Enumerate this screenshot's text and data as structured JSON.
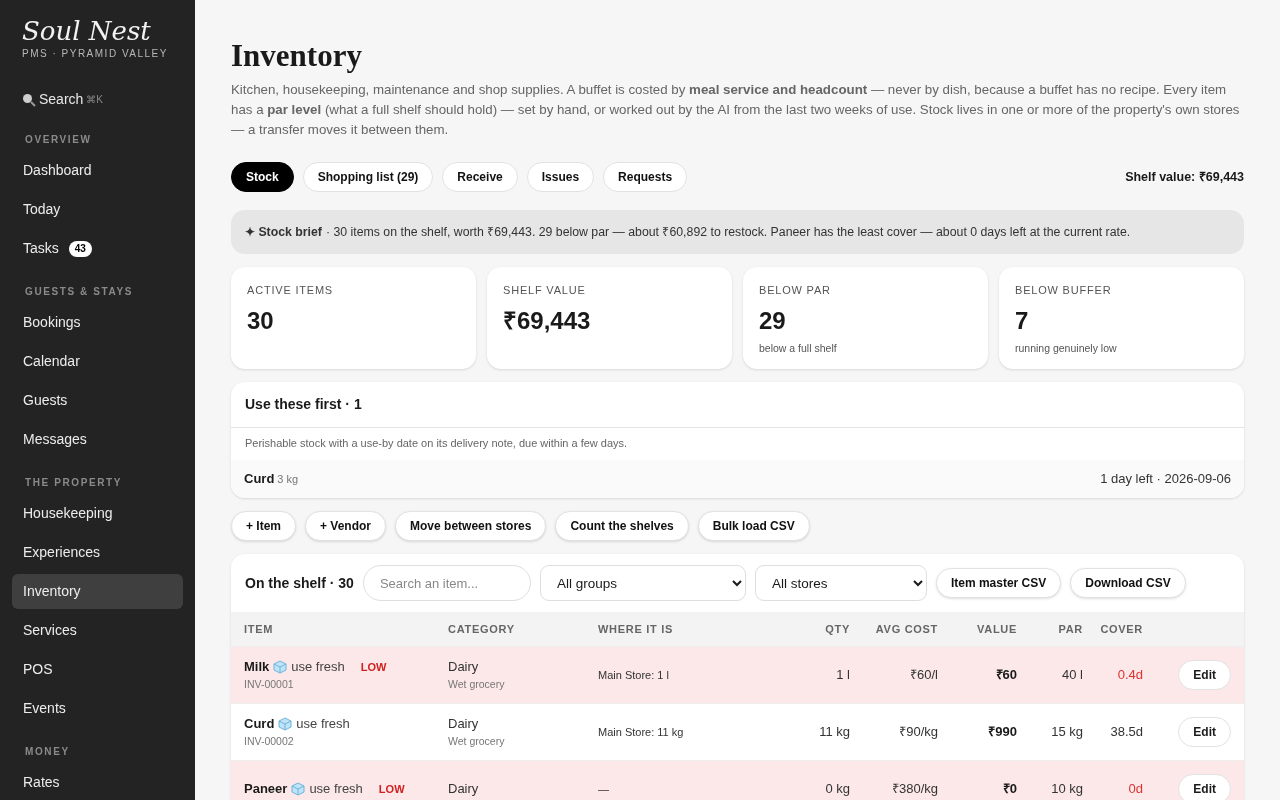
{
  "brand": {
    "logo": "Soul Nest",
    "subtitle": "PMS · PYRAMID VALLEY"
  },
  "search": {
    "label": "Search",
    "shortcut": "⌘K"
  },
  "sidebar": {
    "sections": [
      {
        "heading": "OVERVIEW",
        "items": [
          {
            "label": "Dashboard",
            "selected": false
          },
          {
            "label": "Today",
            "selected": false
          },
          {
            "label": "Tasks",
            "selected": false,
            "badge": "43"
          }
        ]
      },
      {
        "heading": "GUESTS & STAYS",
        "items": [
          {
            "label": "Bookings",
            "selected": false
          },
          {
            "label": "Calendar",
            "selected": false
          },
          {
            "label": "Guests",
            "selected": false
          },
          {
            "label": "Messages",
            "selected": false
          }
        ]
      },
      {
        "heading": "THE PROPERTY",
        "items": [
          {
            "label": "Housekeeping",
            "selected": false
          },
          {
            "label": "Experiences",
            "selected": false
          },
          {
            "label": "Inventory",
            "selected": true
          },
          {
            "label": "Services",
            "selected": false
          },
          {
            "label": "POS",
            "selected": false
          },
          {
            "label": "Events",
            "selected": false
          }
        ]
      },
      {
        "heading": "MONEY",
        "items": [
          {
            "label": "Rates",
            "selected": false
          }
        ]
      }
    ]
  },
  "page": {
    "title": "Inventory",
    "description": "Kitchen, housekeeping, maintenance and shop supplies. A buffet is costed by **meal service and headcount** — never by dish, because a buffet has no recipe. Every item has a **par level** (what a full shelf should hold) — set by hand, or worked out by the AI from the last two weeks of use. Stock lives in one or more of the property's own stores — a transfer moves it between them."
  },
  "tabs": [
    {
      "label": "Stock",
      "selected": true
    },
    {
      "label": "Shopping list (29)",
      "selected": false
    },
    {
      "label": "Receive",
      "selected": false
    },
    {
      "label": "Issues",
      "selected": false
    },
    {
      "label": "Requests",
      "selected": false
    }
  ],
  "shelf_value": "Shelf value: ₹69,443",
  "brief": {
    "label": "✦ Stock brief",
    "text": "· 30 items on the shelf, worth ₹69,443. 29 below par — about ₹60,892 to restock. Paneer has the least cover — about 0 days left at the current rate."
  },
  "stats": [
    {
      "label": "ACTIVE ITEMS",
      "value": "30"
    },
    {
      "label": "SHELF VALUE",
      "value": "₹69,443"
    },
    {
      "label": "BELOW PAR",
      "value": "29",
      "note": "below a full shelf"
    },
    {
      "label": "BELOW BUFFER",
      "value": "7",
      "note": "running genuinely low"
    }
  ],
  "use_first": {
    "title": "Use these first · 1",
    "description": "Perishable stock with a use-by date on its delivery note, due within a few days.",
    "items": [
      {
        "name": "Curd",
        "qty": "3 kg",
        "due": "1 day left · 2026-09-06"
      }
    ]
  },
  "actions": [
    "+ Item",
    "+ Vendor",
    "Move between stores",
    "Count the shelves",
    "Bulk load CSV"
  ],
  "shelf": {
    "title": "On the shelf · 30",
    "search_placeholder": "Search an item...",
    "group_filter": "All groups",
    "store_filter": "All stores",
    "buttons": [
      "Item master CSV",
      "Download CSV"
    ],
    "columns": [
      "ITEM",
      "CATEGORY",
      "WHERE IT IS",
      "QTY",
      "AVG COST",
      "VALUE",
      "PAR",
      "COVER"
    ],
    "rows": [
      {
        "name": "Milk",
        "tag": "use fresh",
        "low": true,
        "flag": "LOW",
        "code": "INV-00001",
        "category": "Dairy",
        "group": "Wet grocery",
        "where": "Main Store: 1 l",
        "qty": "1 l",
        "avg_cost": "₹60/l",
        "value": "₹60",
        "par": "40 l",
        "cover": "0.4d",
        "action": "Edit"
      },
      {
        "name": "Curd",
        "tag": "use fresh",
        "low": false,
        "code": "INV-00002",
        "category": "Dairy",
        "group": "Wet grocery",
        "where": "Main Store: 11 kg",
        "qty": "11 kg",
        "avg_cost": "₹90/kg",
        "value": "₹990",
        "par": "15 kg",
        "cover": "38.5d",
        "action": "Edit"
      },
      {
        "name": "Paneer",
        "tag": "use fresh",
        "low": true,
        "flag": "LOW",
        "category": "Dairy",
        "where": "—",
        "qty": "0 kg",
        "avg_cost": "₹380/kg",
        "value": "₹0",
        "par": "10 kg",
        "cover": "0d",
        "action": "Edit"
      }
    ]
  }
}
